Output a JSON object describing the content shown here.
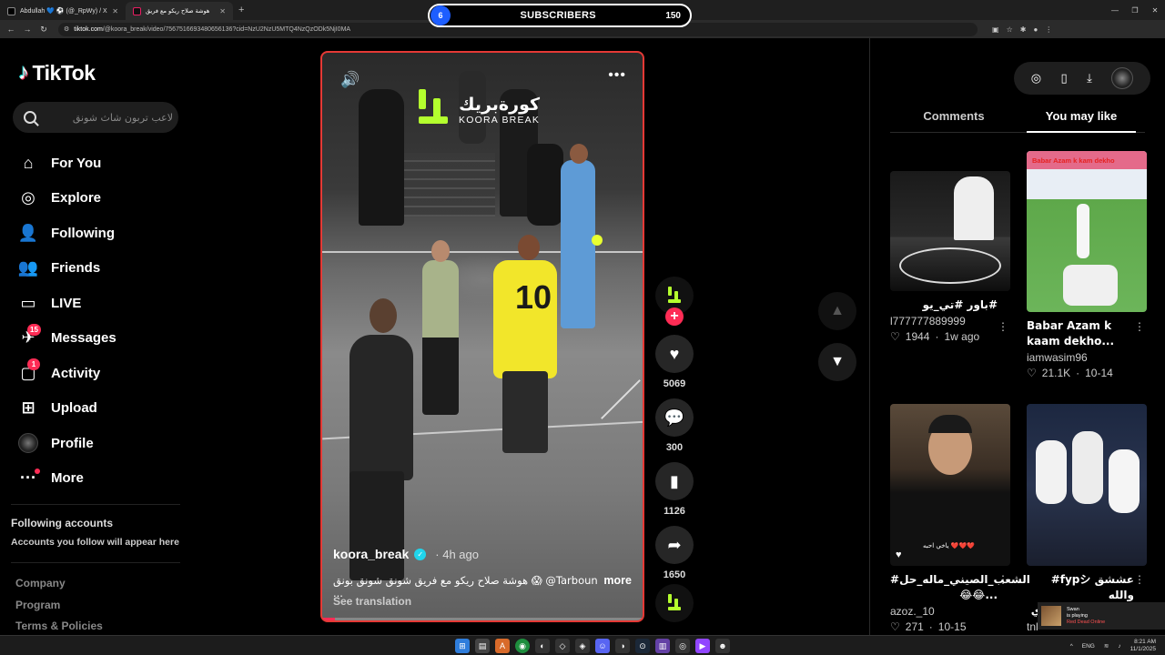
{
  "browser": {
    "tabs": [
      {
        "title": "Abdullah 💙 ⚽ (@_RpWy) / X"
      },
      {
        "title": "هوشة صلاح ريكو مع فريق"
      }
    ],
    "url_host": "tiktok.com",
    "url_path": "/@koora_break/video/7567516693480656136?cid=NzU2NzU5MTQ4NzQzODk5NjI0MA"
  },
  "subscribers_widget": {
    "left_count": "6",
    "label": "SUBSCRIBERS",
    "right_count": "150"
  },
  "sidebar": {
    "logo": "TikTok",
    "search_placeholder": "لاعب تربون شاث شونق",
    "items": [
      {
        "label": "For You",
        "icon": "home-icon"
      },
      {
        "label": "Explore",
        "icon": "compass-icon"
      },
      {
        "label": "Following",
        "icon": "following-icon"
      },
      {
        "label": "Friends",
        "icon": "friends-icon"
      },
      {
        "label": "LIVE",
        "icon": "live-icon"
      },
      {
        "label": "Messages",
        "icon": "messages-icon",
        "badge": "15"
      },
      {
        "label": "Activity",
        "icon": "activity-icon",
        "badge": "1"
      },
      {
        "label": "Upload",
        "icon": "upload-icon"
      },
      {
        "label": "Profile",
        "icon": "avatar"
      },
      {
        "label": "More",
        "icon": "more-icon"
      }
    ],
    "following_heading": "Following accounts",
    "following_sub": "Accounts you follow will appear here",
    "footer": [
      "Company",
      "Program",
      "Terms & Policies"
    ]
  },
  "video": {
    "brand_arabic": "كورةبريك",
    "brand_english": "KOORA BREAK",
    "username": "koora_break",
    "posted": "· 4h ago",
    "caption": "هوشة صلاح ريكو مع فريق شونق شونق بونق 😱 @Tarboun ...",
    "more_label": "more",
    "see_translation": "See translation",
    "progress": 0.04
  },
  "actions": {
    "likes": "5069",
    "comments": "300",
    "saves": "1126",
    "shares": "1650"
  },
  "right_panel": {
    "tabs": [
      "Comments",
      "You may like"
    ],
    "active_tab": 1,
    "cards": [
      {
        "title": "باور #تي_يو#",
        "author": "l777777889999",
        "likes": "1944",
        "date": "1w ago"
      },
      {
        "title": "Babar Azam k kaam dekho...",
        "author": "iamwasim96",
        "likes": "21.1K",
        "date": "10-14",
        "thumb_text": "Babar Azam k kam dekho"
      },
      {
        "title": "#الشعب_الصيني_ماله_حل 😂😂...",
        "author": "azoz._10",
        "likes": "271",
        "date": "10-15",
        "thumb_text": "ياخي احبه ❤️❤️❤️"
      },
      {
        "title": "#fypシ عششق والله #سالم_الدوسري...",
        "author": "tnl",
        "likes": "",
        "date": ""
      }
    ]
  },
  "overlay": {
    "name": "Swan",
    "status": "is playing",
    "game": "Red Dead Online"
  },
  "taskbar": {
    "lang": "ENG",
    "time": "8:21 AM",
    "date": "11/1/2025"
  },
  "colors": {
    "accent": "#fe2c55",
    "brand_green": "#b4ff2e",
    "verified": "#20d5ec"
  }
}
